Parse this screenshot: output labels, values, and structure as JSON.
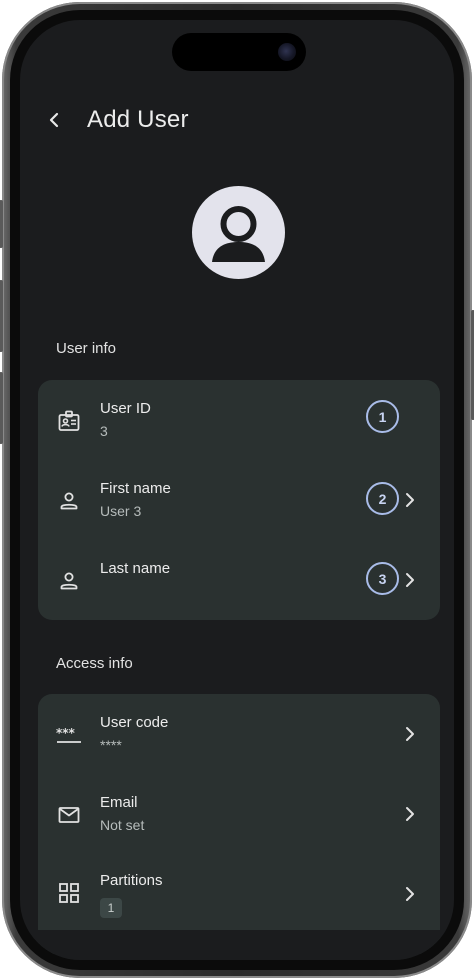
{
  "header": {
    "title": "Add User",
    "back_icon": "back-arrow-icon"
  },
  "avatar": {
    "icon": "account-circle-icon",
    "color": "#e3e3ec"
  },
  "user_info": {
    "section_label": "User info",
    "rows": [
      {
        "label": "User ID",
        "value": "3",
        "icon": "badge-icon",
        "step": "1"
      },
      {
        "label": "First name",
        "value": "User 3",
        "icon": "person-icon",
        "step": "2"
      },
      {
        "label": "Last name",
        "value": "",
        "icon": "person-icon",
        "step": "3"
      }
    ]
  },
  "access_info": {
    "section_label": "Access info",
    "rows": [
      {
        "label": "User code",
        "value": "****",
        "icon": "password-icon"
      },
      {
        "label": "Email",
        "value": "Not set",
        "icon": "mail-icon"
      },
      {
        "label": "Partitions",
        "value": "1",
        "icon": "grid-icon"
      }
    ]
  },
  "colors": {
    "background": "#1b1c1e",
    "card": "#2a3130",
    "step_outline": "#a9bce8"
  }
}
